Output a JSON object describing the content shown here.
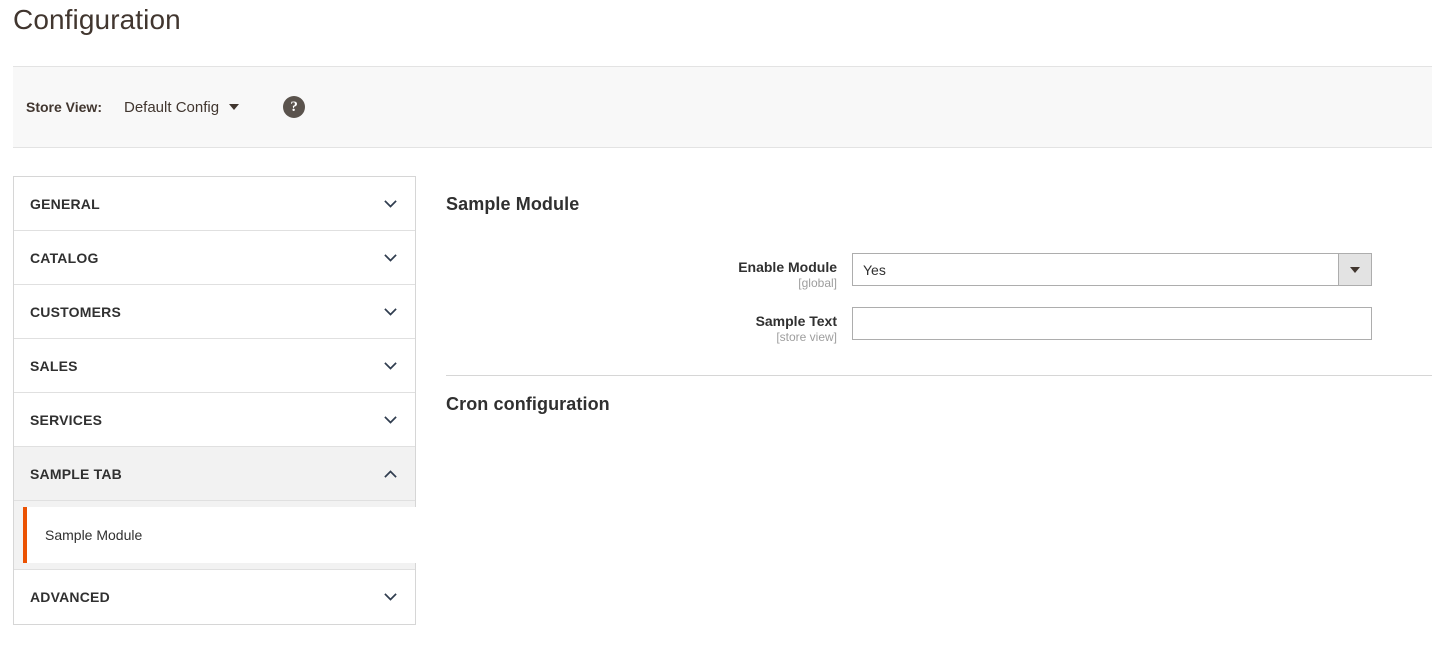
{
  "page": {
    "title": "Configuration"
  },
  "switcher": {
    "label": "Store View:",
    "value": "Default Config",
    "caret_icon": "caret-down-icon",
    "help_icon": "help-icon",
    "help_glyph": "?"
  },
  "sidebar": {
    "sections": [
      {
        "label": "GENERAL",
        "expanded": false,
        "icon": "chevron-down-icon"
      },
      {
        "label": "CATALOG",
        "expanded": false,
        "icon": "chevron-down-icon"
      },
      {
        "label": "CUSTOMERS",
        "expanded": false,
        "icon": "chevron-down-icon"
      },
      {
        "label": "SALES",
        "expanded": false,
        "icon": "chevron-down-icon"
      },
      {
        "label": "SERVICES",
        "expanded": false,
        "icon": "chevron-down-icon"
      },
      {
        "label": "SAMPLE TAB",
        "expanded": true,
        "icon": "chevron-up-icon",
        "items": [
          {
            "label": "Sample Module",
            "current": true
          }
        ]
      },
      {
        "label": "ADVANCED",
        "expanded": false,
        "icon": "chevron-down-icon"
      }
    ]
  },
  "main": {
    "section_title": "Sample Module",
    "fields": [
      {
        "label": "Enable Module",
        "scope": "[global]",
        "type": "select",
        "value": "Yes",
        "dropdown_icon": "caret-down-icon"
      },
      {
        "label": "Sample Text",
        "scope": "[store view]",
        "type": "text",
        "value": "",
        "placeholder": ""
      }
    ],
    "cron_title": "Cron configuration"
  },
  "colors": {
    "accent": "#eb5202",
    "title": "#41362f",
    "text": "#303030",
    "scope": "#9e9e9e",
    "border": "#adadad",
    "panel_border": "#d6d6d6",
    "bar_bg": "#f8f8f8",
    "active_bg": "#f2f2f2",
    "help_bg": "#5a534d"
  }
}
